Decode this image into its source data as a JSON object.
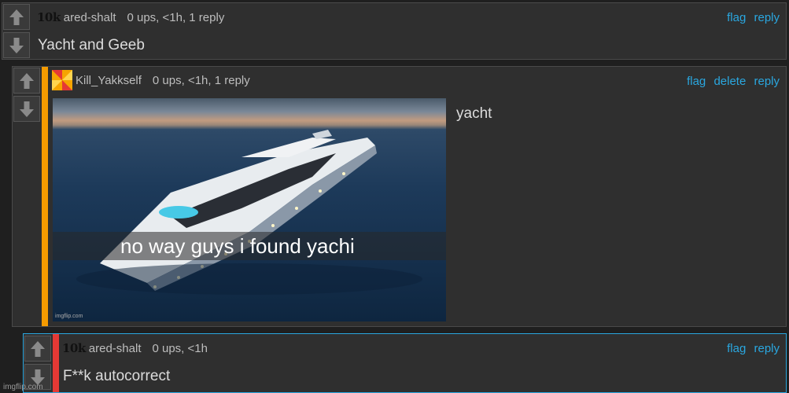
{
  "comments": [
    {
      "badge": "10k",
      "username": "ared-shalt",
      "meta": "0 ups, <1h, 1 reply",
      "actions": [
        "flag",
        "reply"
      ],
      "text": "Yacht and Geeb"
    },
    {
      "username": "Kill_Yakkself",
      "meta": "0 ups, <1h, 1 reply",
      "actions": [
        "flag",
        "delete",
        "reply"
      ],
      "text": "yacht",
      "image": {
        "caption": "no way guys i found yachi",
        "watermark": "imgflip.com"
      },
      "stripe_color": "#f59b00"
    },
    {
      "badge": "10k",
      "username": "ared-shalt",
      "meta": "0 ups, <1h",
      "actions": [
        "flag",
        "reply"
      ],
      "text": "F**k autocorrect",
      "stripe_color": "#e53935"
    }
  ],
  "footer_watermark": "imgflip.com",
  "icons": {
    "upvote": "arrow-up-icon",
    "downvote": "arrow-down-icon"
  }
}
